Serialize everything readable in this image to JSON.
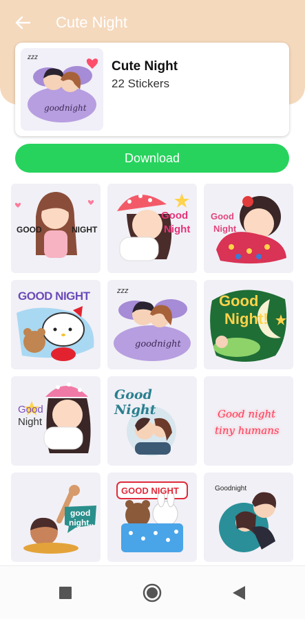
{
  "header": {
    "title": "Cute Night",
    "back_icon": "arrow-left-icon",
    "bg_color": "#f5d9bd"
  },
  "pack": {
    "name": "Cute Night",
    "count": "22 Stickers"
  },
  "download": {
    "label": "Download",
    "color": "#27d35d"
  },
  "stickers": [
    {
      "name": "girl-wink-heart",
      "texts": [
        "GOOD",
        "NIGHT"
      ]
    },
    {
      "name": "girl-pillow-nightcap",
      "texts": [
        "Good",
        "Night"
      ]
    },
    {
      "name": "girl-sleeping-quilt",
      "texts": [
        "Good",
        "Night"
      ]
    },
    {
      "name": "hello-kitty-teddy",
      "texts": [
        "GOOD NIGHT"
      ]
    },
    {
      "name": "couple-cuddle-bed",
      "texts": [
        "zzz",
        "goodnight"
      ]
    },
    {
      "name": "night-moon-stars",
      "texts": [
        "Good",
        "Night!"
      ]
    },
    {
      "name": "girl-hug-pillow",
      "texts": [
        "Good",
        "Night"
      ]
    },
    {
      "name": "couple-kiss-circle",
      "texts": [
        "Good Night"
      ]
    },
    {
      "name": "neon-text",
      "texts": [
        "Good night",
        "tiny humans"
      ]
    },
    {
      "name": "boy-waving-bubble",
      "texts": [
        "good",
        "night.."
      ]
    },
    {
      "name": "bears-bed-banner",
      "texts": [
        "GOOD NIGHT"
      ]
    },
    {
      "name": "couple-hug-circle",
      "texts": [
        "Goodnight"
      ]
    }
  ],
  "nav": {
    "icons": [
      "square-icon",
      "circle-home-icon",
      "triangle-back-icon"
    ]
  }
}
